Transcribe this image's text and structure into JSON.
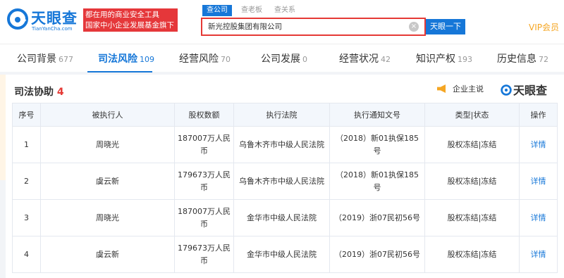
{
  "header": {
    "logo_cn": "天眼查",
    "logo_en": "TianYanCha.com",
    "slogan_line1": "都在用的商业安全工具",
    "slogan_line2": "国家中小企业发展基金旗下",
    "search_tabs": [
      "查公司",
      "查老板",
      "查关系"
    ],
    "search_value": "新光控股集团有限公司",
    "search_button": "天眼一下",
    "vip_label": "VIP会员"
  },
  "tabs": [
    {
      "label": "公司背景",
      "count": "677"
    },
    {
      "label": "司法风险",
      "count": "109"
    },
    {
      "label": "经营风险",
      "count": "70"
    },
    {
      "label": "公司发展",
      "count": "0"
    },
    {
      "label": "经营状况",
      "count": "42"
    },
    {
      "label": "知识产权",
      "count": "193"
    },
    {
      "label": "历史信息",
      "count": "72"
    }
  ],
  "section": {
    "title": "司法协助",
    "count": "4",
    "owner_label": "企业主说",
    "watermark": "天眼查"
  },
  "table": {
    "columns": [
      "序号",
      "被执行人",
      "股权数额",
      "执行法院",
      "执行通知文号",
      "类型|状态",
      "操作"
    ],
    "rows": [
      {
        "no": "1",
        "person": "周晓光",
        "amount": "187007万人民币",
        "court": "乌鲁木齐市中级人民法院",
        "doc": "（2018）新01执保185号",
        "status": "股权冻结|冻结",
        "action": "详情"
      },
      {
        "no": "2",
        "person": "虞云新",
        "amount": "179673万人民币",
        "court": "乌鲁木齐市中级人民法院",
        "doc": "（2018）新01执保185号",
        "status": "股权冻结|冻结",
        "action": "详情"
      },
      {
        "no": "3",
        "person": "周晓光",
        "amount": "187007万人民币",
        "court": "金华市中级人民法院",
        "doc": "（2019）浙07民初56号",
        "status": "股权冻结|冻结",
        "action": "详情"
      },
      {
        "no": "4",
        "person": "虞云新",
        "amount": "179673万人民币",
        "court": "金华市中级人民法院",
        "doc": "（2019）浙07民初56号",
        "status": "股权冻结|冻结",
        "action": "详情"
      }
    ]
  },
  "colors": {
    "brand": "#1677d8",
    "alert": "#e53935",
    "vip": "#f5a623"
  },
  "icons": [
    "logo-mark-icon",
    "clear-icon",
    "megaphone-icon"
  ]
}
